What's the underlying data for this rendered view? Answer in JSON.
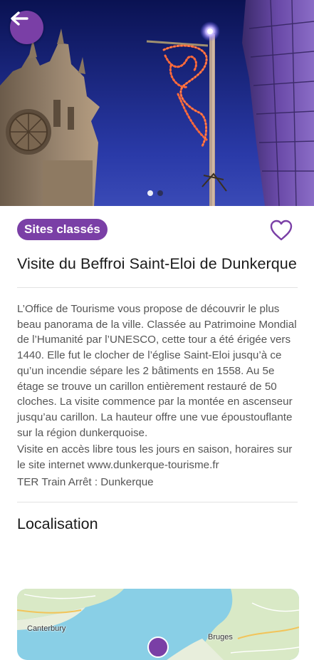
{
  "header": {
    "back_icon": "arrow-left-icon",
    "carousel": {
      "slide_count": 2,
      "active_index": 0
    }
  },
  "poi": {
    "category": "Sites classés",
    "favorite_icon": "heart-outline-icon",
    "title": "Visite du Beffroi Saint-Eloi de Dunkerque",
    "description": "L’Office de Tourisme vous propose de découvrir le plus beau panorama de la ville. Classée au Patrimoine Mondial de l’Humanité par l’UNESCO, cette tour a été érigée vers 1440. Elle fut le clocher de l’église Saint-Eloi jusqu’à ce qu’un incendie sépare les 2 bâtiments en 1558. Au 5e étage se trouve un carillon entièrement restauré de 50 cloches. La visite commence par la montée en ascenseur jusqu’au carillon. La hauteur offre une vue époustouflante sur la région dunkerquoise.",
    "access_info": "Visite en accès libre tous les jours en saison, horaires sur le site internet www.dunkerque-tourisme.fr",
    "transport_info": "TER Train Arrêt : Dunkerque"
  },
  "location": {
    "section_title": "Localisation",
    "map_labels": {
      "city_1": "Canterbury",
      "city_2": "Bruges"
    }
  },
  "colors": {
    "accent": "#7a3fa6",
    "text": "#222222",
    "muted_text": "#555555"
  }
}
